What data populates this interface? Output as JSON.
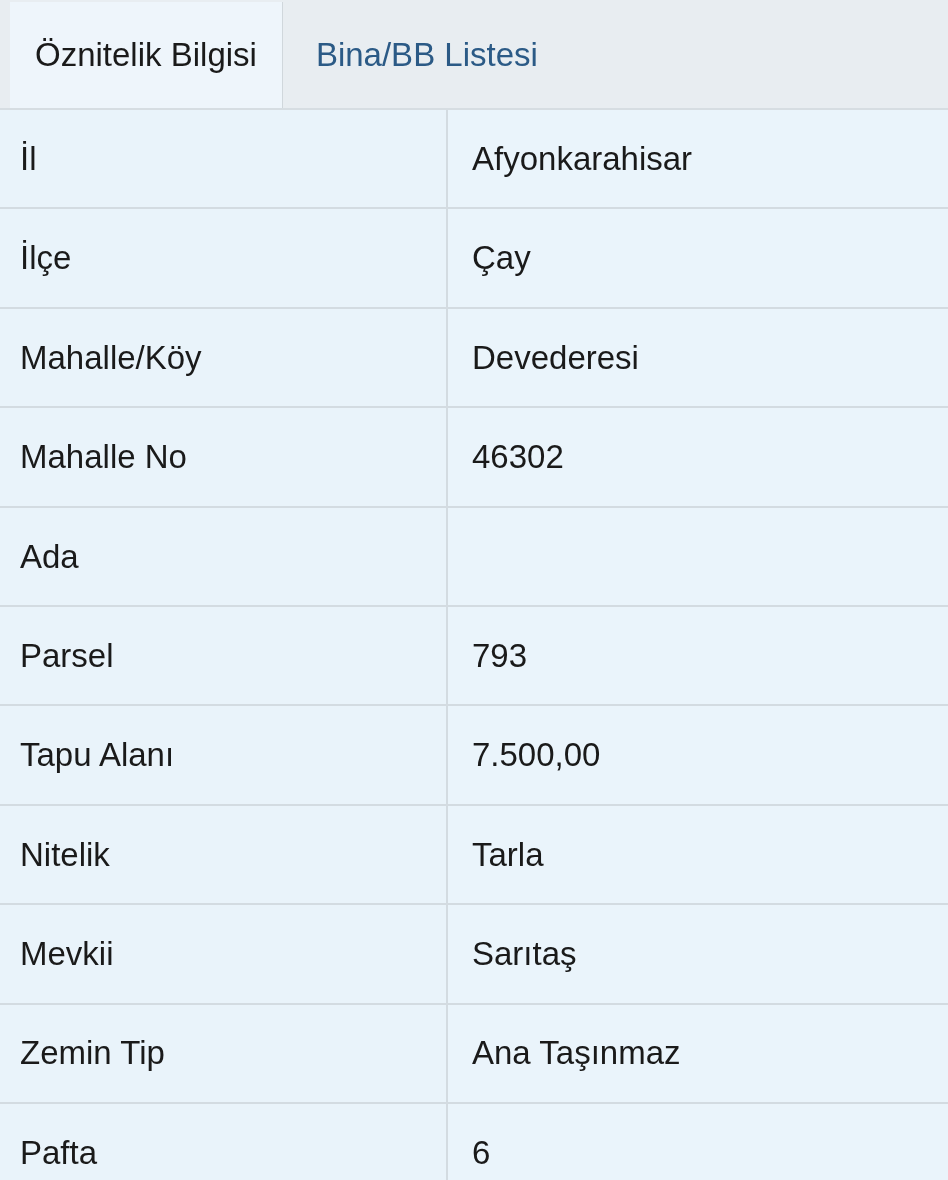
{
  "tabs": [
    {
      "label": "Öznitelik Bilgisi",
      "selected": true
    },
    {
      "label": "Bina/BB Listesi",
      "selected": false
    }
  ],
  "table": {
    "rows": [
      {
        "label": "İl",
        "value": "Afyonkarahisar"
      },
      {
        "label": "İlçe",
        "value": "Çay"
      },
      {
        "label": "Mahalle/Köy",
        "value": "Devederesi"
      },
      {
        "label": "Mahalle No",
        "value": "46302"
      },
      {
        "label": "Ada"
      },
      {
        "label": "Parsel",
        "value": "793"
      },
      {
        "label": "Tapu Alanı",
        "value": "7.500,00"
      },
      {
        "label": "Nitelik",
        "value": "Tarla"
      },
      {
        "label": "Mevkii",
        "value": "Sarıtaş"
      },
      {
        "label": "Zemin Tip",
        "value": "Ana Taşınmaz"
      },
      {
        "label": "Pafta",
        "value": "6"
      }
    ]
  }
}
